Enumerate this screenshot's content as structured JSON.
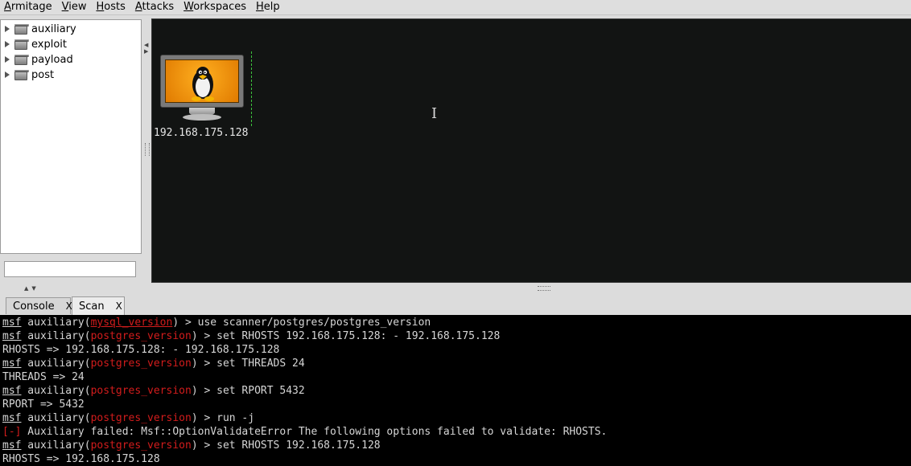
{
  "menubar": {
    "items": [
      {
        "mnemonic": "A",
        "rest": "rmitage"
      },
      {
        "mnemonic": "V",
        "rest": "iew"
      },
      {
        "mnemonic": "H",
        "rest": "osts"
      },
      {
        "mnemonic": "A",
        "rest": "ttacks"
      },
      {
        "mnemonic": "W",
        "rest": "orkspaces"
      },
      {
        "mnemonic": "H",
        "rest": "elp"
      }
    ]
  },
  "module_tree": {
    "items": [
      "auxiliary",
      "exploit",
      "payload",
      "post"
    ],
    "search_value": ""
  },
  "graph": {
    "host": {
      "ip": "192.168.175.128",
      "os_icon": "linux-penguin-icon"
    },
    "colors": {
      "background": "#121413",
      "screen": "#f39a0f",
      "selection": "#3cc23c"
    }
  },
  "tabs": [
    {
      "label": "Console",
      "close": "X"
    },
    {
      "label": "Scan",
      "close": "X"
    }
  ],
  "console": {
    "prompt_prefix": "msf",
    "l1": {
      "a": " auxiliary(",
      "mod": "mysql_version",
      "b": ") > use scanner/postgres/postgres_version"
    },
    "l2": {
      "a": " auxiliary(",
      "mod": "postgres_version",
      "b": ") > set RHOSTS 192.168.175.128: - 192.168.175.128"
    },
    "l3": "RHOSTS => 192.168.175.128: - 192.168.175.128",
    "l4": {
      "a": " auxiliary(",
      "mod": "postgres_version",
      "b": ") > set THREADS 24"
    },
    "l5": "THREADS => 24",
    "l6": {
      "a": " auxiliary(",
      "mod": "postgres_version",
      "b": ") > set RPORT 5432"
    },
    "l7": "RPORT => 5432",
    "l8": {
      "a": " auxiliary(",
      "mod": "postgres_version",
      "b": ") > run -j"
    },
    "l9": {
      "tag": "[-]",
      "text": " Auxiliary failed: Msf::OptionValidateError The following options failed to validate: RHOSTS."
    },
    "l10": {
      "a": " auxiliary(",
      "mod": "postgres_version",
      "b": ") > set RHOSTS 192.168.175.128"
    },
    "l11": "RHOSTS => 192.168.175.128"
  }
}
